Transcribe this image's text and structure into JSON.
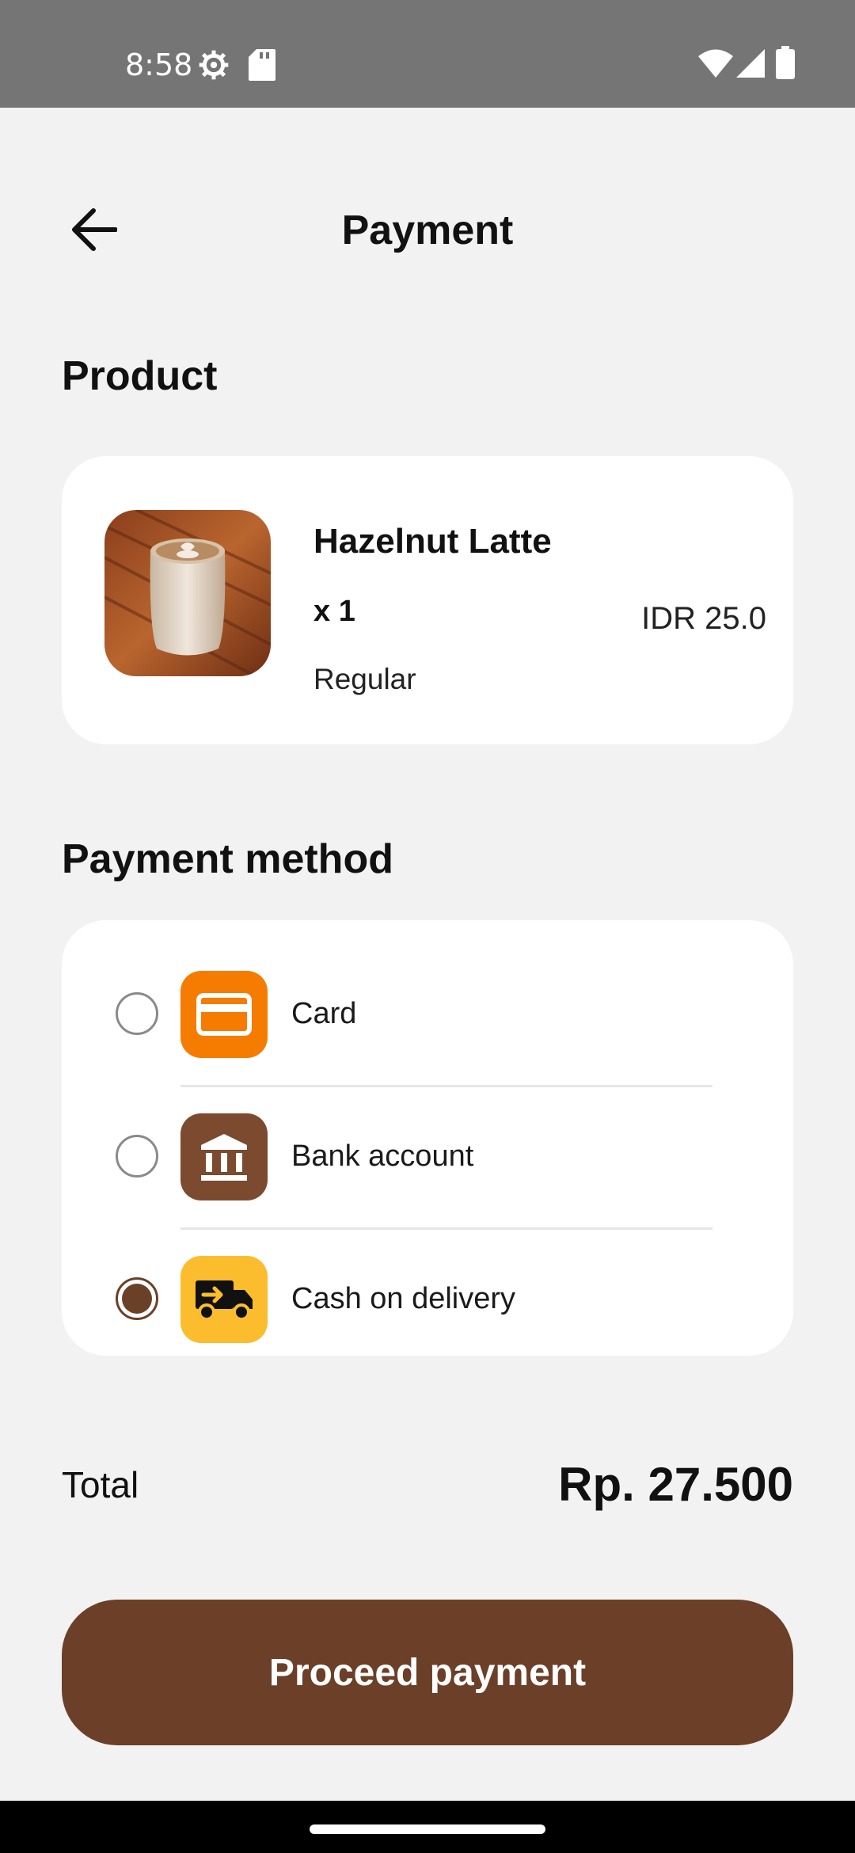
{
  "status_bar": {
    "time": "8:58",
    "icons": [
      "settings-icon",
      "sd-card-icon",
      "wifi-icon",
      "signal-icon",
      "battery-icon"
    ]
  },
  "header": {
    "title": "Payment",
    "back_icon": "arrow-back-icon"
  },
  "product_section": {
    "title": "Product",
    "item": {
      "name": "Hazelnut Latte",
      "quantity": "x 1",
      "price": "IDR 25.0",
      "size": "Regular",
      "image": "latte-photo"
    }
  },
  "payment_section": {
    "title": "Payment method",
    "methods": [
      {
        "label": "Card",
        "icon": "credit-card-icon",
        "color": "#f57c00",
        "selected": false
      },
      {
        "label": "Bank account",
        "icon": "bank-icon",
        "color": "#7b4a2f",
        "selected": false
      },
      {
        "label": "Cash on delivery",
        "icon": "delivery-truck-icon",
        "color": "#fbbd2e",
        "selected": true
      }
    ]
  },
  "total": {
    "label": "Total",
    "value": "Rp. 27.500"
  },
  "proceed_button": {
    "label": "Proceed payment"
  },
  "colors": {
    "brand": "#6b3f28",
    "background": "#f2f2f2",
    "status_bar": "#757575"
  }
}
